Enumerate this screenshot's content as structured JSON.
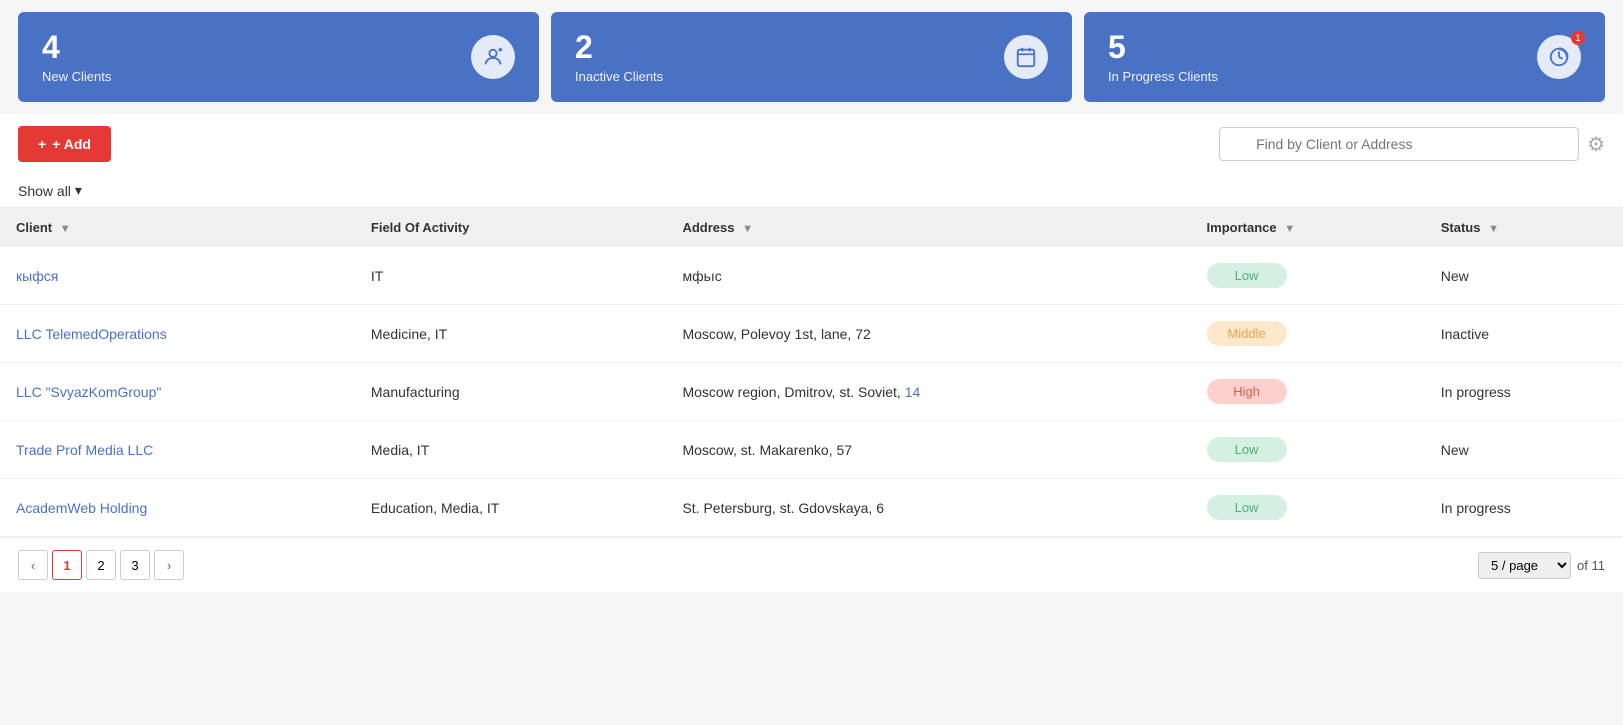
{
  "cards": [
    {
      "number": "4",
      "label": "New Clients",
      "icon": "👤"
    },
    {
      "number": "2",
      "label": "Inactive Clients",
      "icon": "📅"
    },
    {
      "number": "5",
      "label": "In Progress Clients",
      "icon": "📊"
    }
  ],
  "toolbar": {
    "add_label": "+ Add",
    "search_placeholder": "Find by Client or Address"
  },
  "filter": {
    "show_all_label": "Show all"
  },
  "table": {
    "columns": [
      {
        "key": "client",
        "label": "Client"
      },
      {
        "key": "field",
        "label": "Field Of Activity"
      },
      {
        "key": "address",
        "label": "Address"
      },
      {
        "key": "importance",
        "label": "Importance"
      },
      {
        "key": "status",
        "label": "Status"
      }
    ],
    "rows": [
      {
        "client": "кыфся",
        "field": "IT",
        "address": "мфьıс",
        "address_highlight": "",
        "importance": "Low",
        "importance_class": "badge-low",
        "status": "New"
      },
      {
        "client": "LLC TelemedOperations",
        "field": "Medicine, IT",
        "address": "Moscow, Polevoy 1st, lane, 72",
        "address_highlight": "",
        "importance": "Middle",
        "importance_class": "badge-middle",
        "status": "Inactive"
      },
      {
        "client": "LLC \"SvyazKomGroup\"",
        "field": "Manufacturing",
        "address": "Moscow region, Dmitrov, st. Soviet, 14",
        "address_highlight": "14",
        "importance": "High",
        "importance_class": "badge-high",
        "status": "In progress"
      },
      {
        "client": "Trade Prof Media LLC",
        "field": "Media, IT",
        "address": "Moscow, st. Makarenko, 57",
        "address_highlight": "",
        "importance": "Low",
        "importance_class": "badge-low",
        "status": "New"
      },
      {
        "client": "AcademWeb Holding",
        "field": "Education, Media, IT",
        "address": "St. Petersburg, st. Gdovskaya, 6",
        "address_highlight": "",
        "importance": "Low",
        "importance_class": "badge-low",
        "status": "In progress"
      }
    ]
  },
  "pagination": {
    "pages": [
      "1",
      "2",
      "3"
    ],
    "active_page": "1",
    "per_page": "5 / page",
    "total_label": "of 11"
  }
}
